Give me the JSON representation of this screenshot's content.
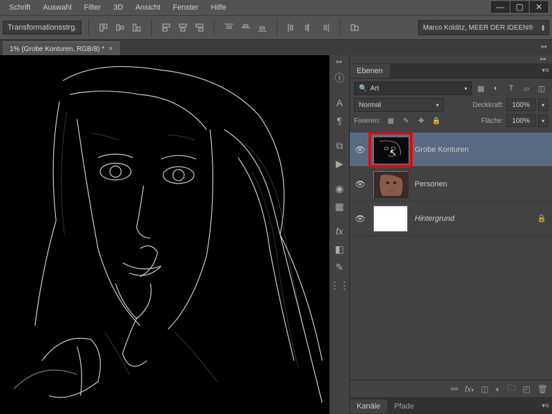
{
  "menu": [
    "Schrift",
    "Auswahl",
    "Filter",
    "3D",
    "Ansicht",
    "Fenster",
    "Hilfe"
  ],
  "optbar": {
    "transform_label": "Transformationsstrg.",
    "workspace": "Marco Kolditz, MEER DER IDEEN®"
  },
  "doc_tab": "1% (Grobe Konturen, RGB/8) *",
  "layers_panel": {
    "title": "Ebenen",
    "search_kind": "Art",
    "blend_mode": "Normal",
    "opacity_label": "Deckkraft:",
    "opacity_value": "100%",
    "fill_label": "Fläche:",
    "fill_value": "100%",
    "lock_label": "Fixieren:"
  },
  "layers": [
    {
      "name": "Grobe Konturen",
      "selected": true,
      "highlight": true,
      "thumb": "fx",
      "locked": false,
      "italic": false
    },
    {
      "name": "Personen",
      "selected": false,
      "thumb": "photo",
      "locked": false,
      "italic": false
    },
    {
      "name": "Hintergrund",
      "selected": false,
      "thumb": "white",
      "locked": true,
      "italic": true
    }
  ],
  "bottom_tabs": {
    "channels": "Kanäle",
    "paths": "Pfade"
  }
}
